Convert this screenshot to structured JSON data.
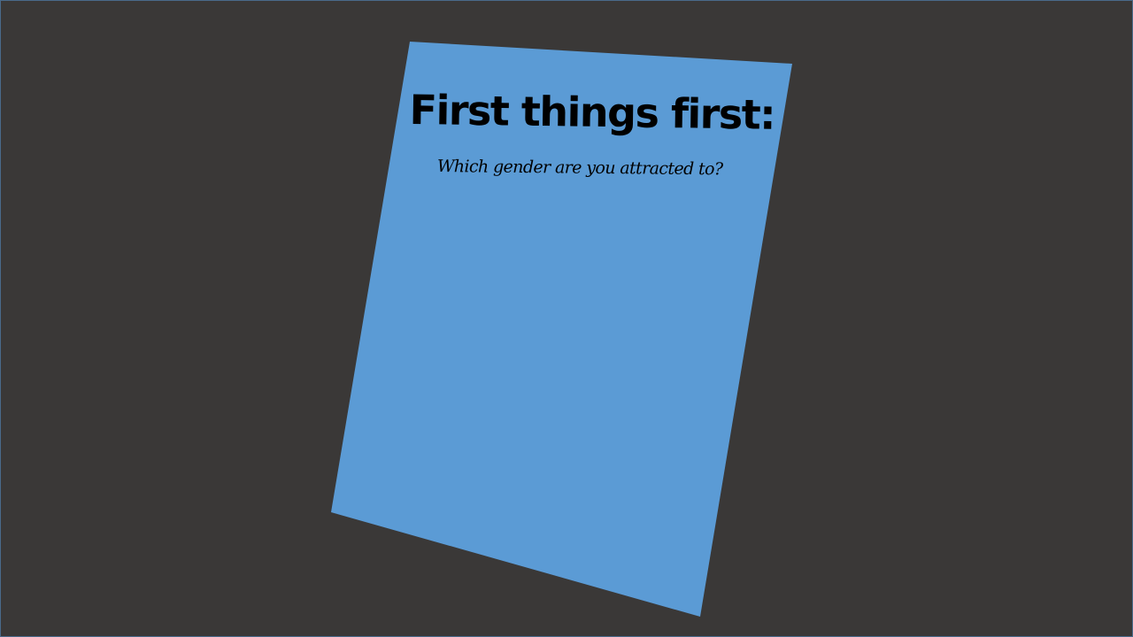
{
  "colors": {
    "background": "#3a3837",
    "card": "#5b9bd5",
    "text": "#000000"
  },
  "card": {
    "title": "First things first:",
    "question": "Which gender are you attracted to?"
  }
}
